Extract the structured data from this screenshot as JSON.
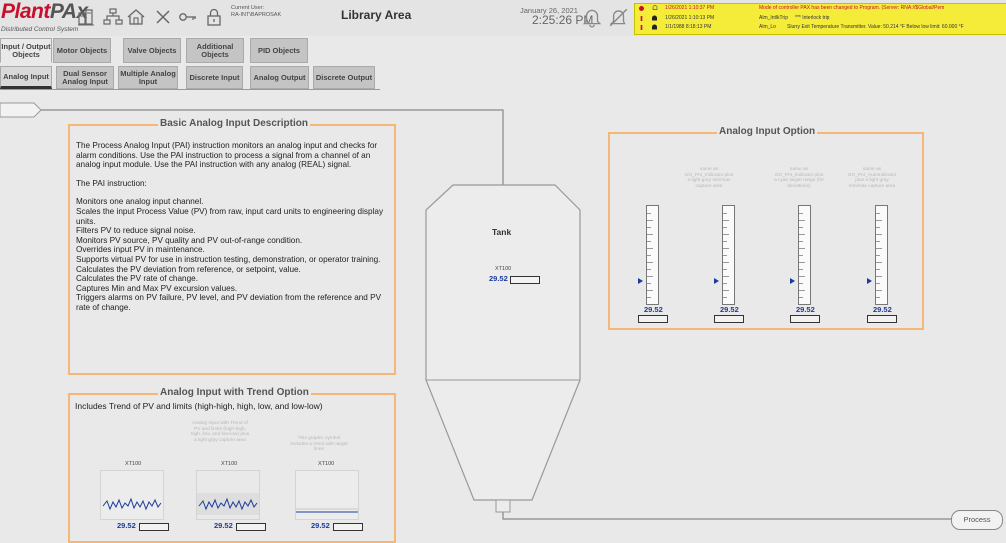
{
  "header": {
    "logo_main": "PlantPAx",
    "logo_sub": "Distributed Control System",
    "user_label": "Current User:",
    "user_name": "RA-INT\\BAPROSAK",
    "page_title": "Library Area",
    "date": "January 26, 2021",
    "time": "2:25:26 PM",
    "icons": [
      "faceplates-icon",
      "hierarchy-icon",
      "home-icon",
      "close-icon",
      "key-icon",
      "lock-icon",
      "bell-icon",
      "mute-icon"
    ]
  },
  "alarms": [
    {
      "time": "1/26/2021 1:10:37 PM",
      "name": "",
      "message": "Mode of controller PAX has been changed to Program. (Server: RNA://$Global/Pem",
      "color": "#c8102e"
    },
    {
      "time": "1/26/2021 1:10:13 PM",
      "name": "Alm_IntlkTrip",
      "message": "*** Interlock trip",
      "color": "#333333"
    },
    {
      "time": "1/1/1988 8:18:13 PM",
      "name": "Alm_Lo",
      "message": "Slurry Exit Temperature Transmitter. Value: 50.214 °F Below low limit: 60.000 °F",
      "color": "#333333"
    }
  ],
  "tabs_top": [
    {
      "label": "Input / Output Objects"
    },
    {
      "label": "Motor Objects"
    },
    {
      "label": "Valve Objects"
    },
    {
      "label": "Additional Objects"
    },
    {
      "label": "PID Objects"
    }
  ],
  "tabs_sub": [
    {
      "label": "Analog Input"
    },
    {
      "label": "Dual Sensor Analog Input"
    },
    {
      "label": "Multiple Analog Input"
    },
    {
      "label": "Discrete Input"
    },
    {
      "label": "Analog Output"
    },
    {
      "label": "Discrete Output"
    }
  ],
  "description": {
    "title": "Basic Analog Input Description",
    "para1": "The Process Analog Input (PAI) instruction monitors an analog input and checks for alarm conditions. Use the PAI instruction to process a signal from a channel of an analog input module. Use the PAI instruction with any analog (REAL) signal.",
    "para2": "The PAI instruction:",
    "bullets": [
      "Monitors one analog input channel.",
      "Scales the input Process Value (PV) from raw, input card units to engineering display units.",
      "Filters PV to reduce signal noise.",
      "Monitors PV source, PV quality and PV out-of-range condition.",
      "Overrides input PV in maintenance.",
      "Supports virtual PV for use in instruction testing, demonstration, or operator training.",
      "Calculates the PV deviation from reference, or setpoint, value.",
      "Calculates the PV rate of change.",
      "Captures Min and Max PV excursion values.",
      "Triggers alarms on PV failure, PV level, and PV deviation from the reference and PV rate of change."
    ]
  },
  "tank": {
    "title": "Tank",
    "tag": "XT100",
    "value": "29.52"
  },
  "option": {
    "title": "Analog Input Option",
    "gauges": [
      {
        "caption": "",
        "value": "29.52",
        "level": 0.24
      },
      {
        "caption": "same as GO_PAI_Indicator plus a light gray min/max capture area",
        "value": "29.52",
        "level": 0.24
      },
      {
        "caption": "same as GO_PAI_Indicator plus a cyan target range (for deviations)",
        "value": "29.52",
        "level": 0.24
      },
      {
        "caption": "same as GO_PAI_AutoIndicator plus a light gray min/max capture area",
        "value": "29.52",
        "level": 0.24
      }
    ]
  },
  "trend": {
    "title": "Analog Input with Trend Option",
    "subtitle": "Includes Trend of PV and limits (high-high, high, low, and low-low)",
    "items": [
      {
        "caption": "",
        "tag": "XT100",
        "value": "29.52"
      },
      {
        "caption": "Analog Input with Trend of PV and limits (high-high, high, low, and low-low) plus a light gray capture area",
        "tag": "XT100",
        "value": "29.52"
      },
      {
        "caption": "This graphic symbol includes a trend with target lines",
        "tag": "XT100",
        "value": "29.52"
      }
    ]
  },
  "process_button": "Process",
  "colors": {
    "accent_orange": "#f4b778",
    "value_blue": "#1c3c9c",
    "alarm_yellow": "#f5ec3a",
    "brand_red": "#c8102e"
  }
}
